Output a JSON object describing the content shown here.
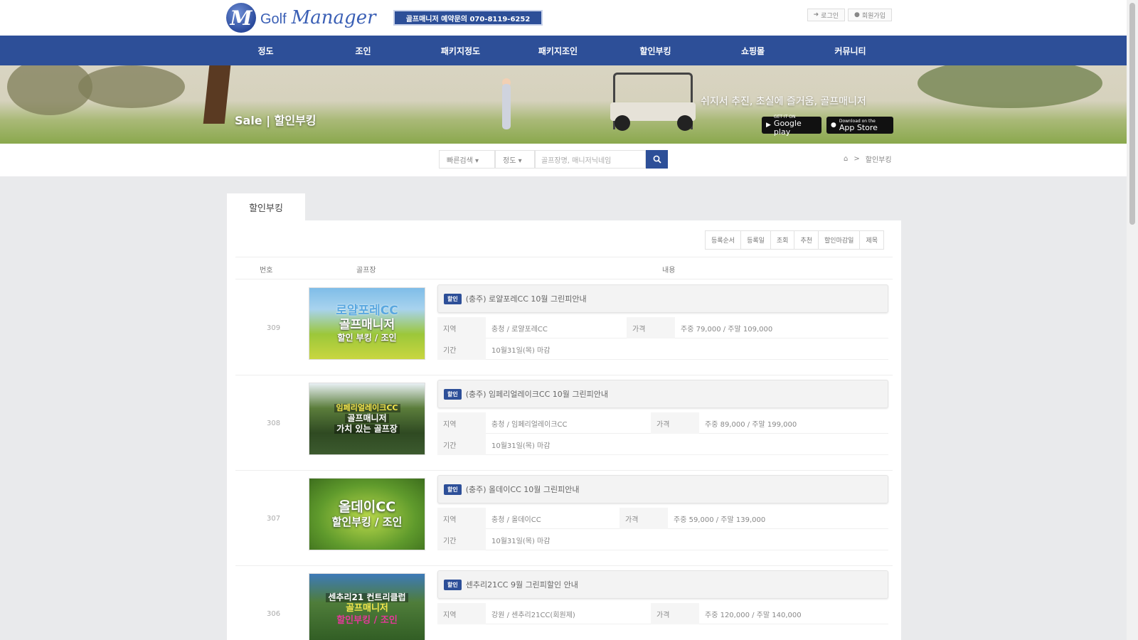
{
  "header": {
    "logo_letter": "M",
    "logo_text_a": "Golf",
    "logo_text_b": "Manager",
    "phone_banner": "골프매니저 예약문의 070-8119-6252",
    "login": "로그인",
    "signup": "회원가입"
  },
  "nav": [
    "정도",
    "조인",
    "패키지정도",
    "패키지조인",
    "할인부킹",
    "쇼핑몰",
    "커뮤니티"
  ],
  "hero": {
    "title": "Sale | 할인부킹",
    "slogan": "쉬지서 추진, 초실에 즐거움, 골프매니저",
    "google_small": "GET IT ON",
    "google_big": "Google play",
    "apple_small": "Download on the",
    "apple_big": "App Store"
  },
  "search": {
    "filter1": "빠른검색 ▾",
    "filter2": "정도 ▾",
    "placeholder": "골프장명, 매니저닉네임",
    "breadcrumb_sep": ">",
    "breadcrumb_current": "할인부킹"
  },
  "content": {
    "tab": "할인부킹",
    "sort": [
      "등록순서",
      "등록일",
      "조회",
      "추천",
      "할인마감일",
      "제목"
    ],
    "headers": {
      "num": "번호",
      "course": "골프장",
      "content": "내용"
    },
    "price_label": "가격",
    "region_label": "지역",
    "period_label": "기간",
    "items": [
      {
        "num": "309",
        "tag": "할인",
        "title": "(충주) 로얄포레CC 10월 그린피안내",
        "region": "충청 / 로얄포레CC",
        "price": "주중 79,000 / 주말 109,000",
        "period": "10월31일(목) 마감",
        "thumb_lines": [
          "로얄포레CC",
          "골프매니저",
          "할인 부킹 / 조인"
        ]
      },
      {
        "num": "308",
        "tag": "할인",
        "title": "(충주) 임페리얼레이크CC 10월 그린피안내",
        "region": "충청 / 임페리얼레이크CC",
        "price": "주중 89,000 / 주말 199,000",
        "period": "10월31일(목) 마감",
        "thumb_lines": [
          "임페리얼레이크CC",
          "골프매니저",
          "가치 있는 골프장"
        ]
      },
      {
        "num": "307",
        "tag": "할인",
        "title": "(충주) 올데이CC 10월 그린피안내",
        "region": "충청 / 올데이CC",
        "price": "주중 59,000 / 주말 139,000",
        "period": "10월31일(목) 마감",
        "thumb_lines": [
          "올데이CC",
          "할인부킹 / 조인"
        ]
      },
      {
        "num": "306",
        "tag": "할인",
        "title": "센추리21CC 9월 그린피할인 안내",
        "region": "강원 / 센추리21CC(회원제)",
        "price": "주중 120,000 / 주말 140,000",
        "period": "",
        "thumb_lines": [
          "센추리21 컨트리클럽",
          "골프매니저",
          "할인부킹 / 조인"
        ]
      }
    ]
  },
  "colors": {
    "primary": "#2d4f98",
    "page_bg": "#e9eaec"
  }
}
